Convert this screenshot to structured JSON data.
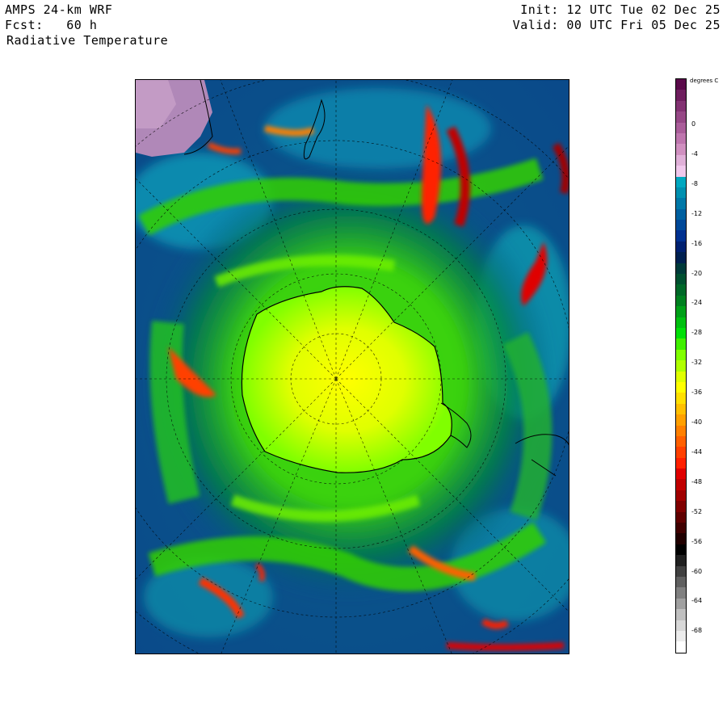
{
  "header": {
    "model": "AMPS 24-km WRF",
    "forecast": "Fcst:   60 h",
    "field": "Radiative Temperature",
    "init": "Init: 12 UTC Tue 02 Dec 25",
    "valid": "Valid: 00 UTC Fri 05 Dec 25"
  },
  "colorbar": {
    "units": "degrees C",
    "labels": [
      "0",
      "-4",
      "-8",
      "-12",
      "-16",
      "-20",
      "-24",
      "-28",
      "-32",
      "-36",
      "-40",
      "-44",
      "-48",
      "-52",
      "-56",
      "-60",
      "-64",
      "-68"
    ],
    "colors": [
      "#5a0a4a",
      "#6e1e5e",
      "#823272",
      "#964886",
      "#aa5e9a",
      "#be76ae",
      "#d090c0",
      "#e0b0d8",
      "#f0c8ec",
      "#00a8c0",
      "#0090b0",
      "#0078a8",
      "#0060a0",
      "#004898",
      "#003090",
      "#002070",
      "#002050",
      "#003a3a",
      "#005030",
      "#006828",
      "#008020",
      "#00a018",
      "#00c010",
      "#00e008",
      "#40f000",
      "#80ff00",
      "#b0ff00",
      "#e0ff00",
      "#ffff00",
      "#ffe000",
      "#ffc000",
      "#ffa000",
      "#ff8000",
      "#ff6000",
      "#ff4000",
      "#ff2000",
      "#e00000",
      "#c00000",
      "#a00000",
      "#800000",
      "#600000",
      "#400000",
      "#200000",
      "#000000",
      "#202020",
      "#404040",
      "#606060",
      "#808080",
      "#a0a0a0",
      "#c0c0c0",
      "#d8d8d8",
      "#ececec",
      "#ffffff"
    ]
  },
  "map": {
    "region": "Antarctica",
    "projection": "polar stereographic"
  }
}
